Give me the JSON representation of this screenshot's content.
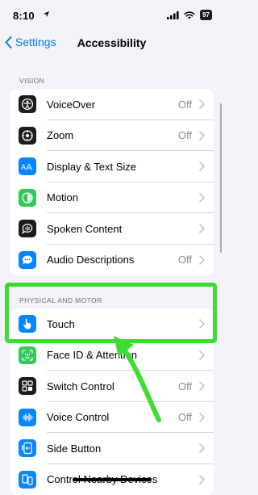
{
  "status": {
    "time": "8:10",
    "battery": "97"
  },
  "nav": {
    "back_label": "Settings",
    "title": "Accessibility"
  },
  "sections": [
    {
      "header": "VISION",
      "items": [
        {
          "label": "VoiceOver",
          "value": "Off",
          "icon": "voiceover-icon",
          "color": "#1c1c1e"
        },
        {
          "label": "Zoom",
          "value": "Off",
          "icon": "zoom-icon",
          "color": "#1c1c1e"
        },
        {
          "label": "Display & Text Size",
          "value": "",
          "icon": "text-size-icon",
          "color": "#0a84ff"
        },
        {
          "label": "Motion",
          "value": "",
          "icon": "motion-icon",
          "color": "#34c759"
        },
        {
          "label": "Spoken Content",
          "value": "",
          "icon": "spoken-content-icon",
          "color": "#1c1c1e"
        },
        {
          "label": "Audio Descriptions",
          "value": "Off",
          "icon": "audio-descriptions-icon",
          "color": "#0a84ff"
        }
      ]
    },
    {
      "header": "PHYSICAL AND MOTOR",
      "items": [
        {
          "label": "Touch",
          "value": "",
          "icon": "touch-icon",
          "color": "#0a84ff"
        },
        {
          "label": "Face ID & Attention",
          "value": "",
          "icon": "face-id-icon",
          "color": "#34c759"
        },
        {
          "label": "Switch Control",
          "value": "Off",
          "icon": "switch-control-icon",
          "color": "#1c1c1e"
        },
        {
          "label": "Voice Control",
          "value": "Off",
          "icon": "voice-control-icon",
          "color": "#0a84ff"
        },
        {
          "label": "Side Button",
          "value": "",
          "icon": "side-button-icon",
          "color": "#0a84ff"
        },
        {
          "label": "Control Nearby Devices",
          "value": "",
          "icon": "nearby-devices-icon",
          "color": "#0a84ff"
        }
      ]
    }
  ],
  "annotation": {
    "highlight_color": "#3ddc32",
    "arrow_color": "#3ddc32"
  }
}
